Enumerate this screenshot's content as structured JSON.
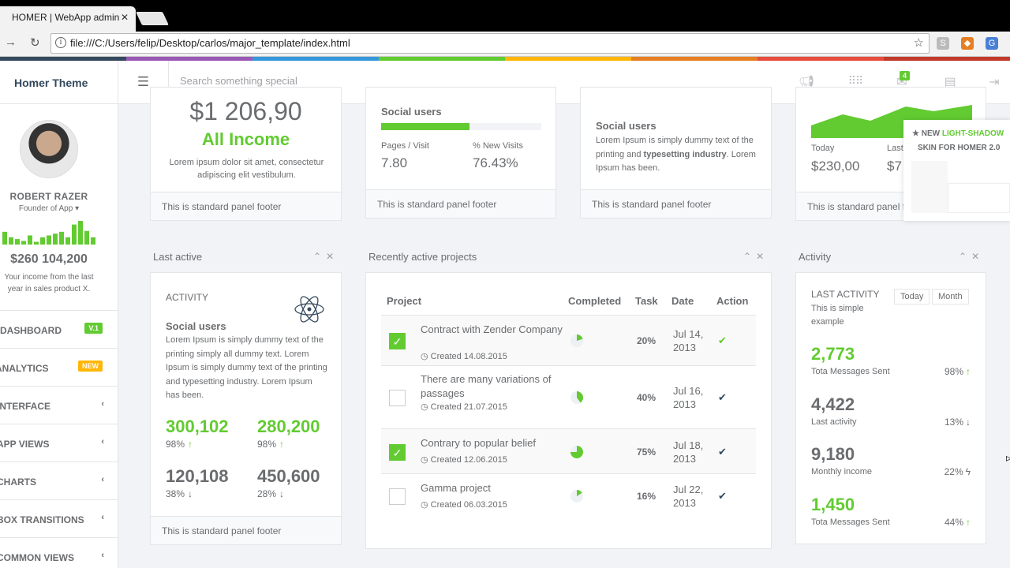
{
  "browser": {
    "tab_title": "HOMER | WebApp admin",
    "url": "file:///C:/Users/felip/Desktop/carlos/major_template/index.html"
  },
  "rainbow": [
    "#34495e",
    "#9b59b6",
    "#3498db",
    "#62cb31",
    "#ffb606",
    "#e67e22",
    "#e74c3c",
    "#c0392b"
  ],
  "header": {
    "brand": "Homer Theme",
    "search_placeholder": "Search something special",
    "mail_badge": "4"
  },
  "profile": {
    "name": "ROBERT RAZER",
    "role": "Founder of App",
    "income": "$260 104,200",
    "note": "Your income from the last year in sales product X."
  },
  "menu": [
    {
      "label": "DASHBOARD",
      "tag": "V.1",
      "tag_color": "#62cb31"
    },
    {
      "label": "ANALYTICS",
      "tag": "NEW",
      "tag_color": "#ffb606"
    },
    {
      "label": "INTERFACE"
    },
    {
      "label": "APP VIEWS"
    },
    {
      "label": "CHARTS"
    },
    {
      "label": "BOX TRANSITIONS"
    },
    {
      "label": "COMMON VIEWS"
    }
  ],
  "top_panels": {
    "income_value": "$1 206,90",
    "income_title": "All Income",
    "income_text": "Lorem ipsum dolor sit amet, consectetur adipiscing elit vestibulum.",
    "social_title": "Social users",
    "social_progress": 0.55,
    "pages_visit_label": "Pages / Visit",
    "pages_visit_value": "7.80",
    "new_visits_label": "% New Visits",
    "new_visits_value": "76.43%",
    "text_title": "Social users",
    "text_body_1": "Lorem Ipsum is simply dummy text of the printing and ",
    "text_body_bold": "typesetting industry",
    "text_body_2": ". Lorem Ipsum has been.",
    "today_label": "Today",
    "today_value": "$230,00",
    "last_label": "Last",
    "last_value": "$7",
    "footer": "This is standard panel footer",
    "footer_clipped": "This is standard panel f"
  },
  "popup": {
    "star_new": "★ NEW ",
    "highlight": "LIGHT-SHADOW",
    "line2": "SKIN FOR HOMER 2.0"
  },
  "last_active": {
    "title": "Last active",
    "heading": "ACTIVITY",
    "sub": "Social users",
    "body": "Lorem Ipsum is simply dummy text of the printing simply all dummy text. Lorem Ipsum is simply dummy text of the printing and typesetting industry. Lorem Ipsum has been.",
    "stats": [
      {
        "value": "300,102",
        "pct": "98%",
        "arrow": "↑",
        "green": true
      },
      {
        "value": "280,200",
        "pct": "98%",
        "arrow": "↑",
        "green": true
      },
      {
        "value": "120,108",
        "pct": "38%",
        "arrow": "↓",
        "green": false
      },
      {
        "value": "450,600",
        "pct": "28%",
        "arrow": "↓",
        "green": false
      }
    ],
    "footer": "This is standard panel footer"
  },
  "projects": {
    "title": "Recently active projects",
    "headers": {
      "project": "Project",
      "completed": "Completed",
      "task": "Task",
      "date": "Date",
      "action": "Action"
    },
    "rows": [
      {
        "checked": true,
        "name": "Contract with Zender Company",
        "created": "Created 14.08.2015",
        "completed": 0.2,
        "task": "20%",
        "date": "Jul 14, 2013",
        "action": "✔",
        "action_green": true
      },
      {
        "checked": false,
        "name": "There are many variations of passages",
        "created": "Created 21.07.2015",
        "completed": 0.4,
        "task": "40%",
        "date": "Jul 16, 2013",
        "action": "✔",
        "action_green": false
      },
      {
        "checked": true,
        "name": "Contrary to popular belief",
        "created": "Created 12.06.2015",
        "completed": 0.75,
        "task": "75%",
        "date": "Jul 18, 2013",
        "action": "✔",
        "action_green": false
      },
      {
        "checked": false,
        "name": "Gamma project",
        "created": "Created 06.03.2015",
        "completed": 0.16,
        "task": "16%",
        "date": "Jul 22, 2013",
        "action": "✔",
        "action_green": false
      }
    ]
  },
  "activity": {
    "title": "Activity",
    "heading": "LAST ACTIVITY",
    "sub": "This is simple example",
    "btn_today": "Today",
    "btn_month": "Month",
    "items": [
      {
        "value": "2,773",
        "label": "Tota Messages Sent",
        "pct": "98%",
        "arrow": "↑",
        "green": true
      },
      {
        "value": "4,422",
        "label": "Last activity",
        "pct": "13%",
        "arrow": "↓",
        "green": false
      },
      {
        "value": "9,180",
        "label": "Monthly income",
        "pct": "22%",
        "arrow": "ϟ",
        "green": false
      },
      {
        "value": "1,450",
        "label": "Tota Messages Sent",
        "pct": "44%",
        "arrow": "↑",
        "green": true
      }
    ]
  },
  "sparkline": [
    14,
    8,
    6,
    4,
    10,
    3,
    8,
    10,
    12,
    14,
    8,
    22,
    26,
    15,
    8
  ]
}
